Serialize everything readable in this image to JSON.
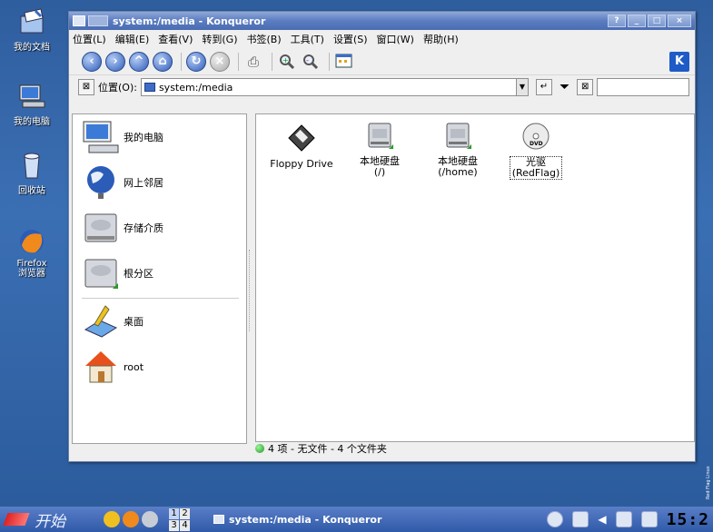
{
  "desktop": {
    "icons": [
      {
        "label": "我的文档",
        "icon": "documents-folder-icon"
      },
      {
        "label": "我的电脑",
        "icon": "computer-icon"
      },
      {
        "label": "回收站",
        "icon": "trash-icon"
      },
      {
        "label": "Firefox\n浏览器",
        "icon": "firefox-icon"
      }
    ],
    "watermark": "Red Flag Linux"
  },
  "window": {
    "title": "system:/media - Konqueror",
    "buttons": [
      "?",
      "_",
      "□",
      "×"
    ],
    "menu": [
      "位置(L)",
      "编辑(E)",
      "查看(V)",
      "转到(G)",
      "书签(B)",
      "工具(T)",
      "设置(S)",
      "窗口(W)",
      "帮助(H)"
    ],
    "toolbar": {
      "back": "back-icon",
      "forward": "forward-icon",
      "up": "up-icon",
      "home": "home-icon",
      "reload": "reload-icon",
      "stop": "stop-icon",
      "print": "print-icon",
      "zoom_in": "zoom-in-icon",
      "zoom_out": "zoom-out-icon",
      "view_mode": "view-mode-icon"
    },
    "location": {
      "label": "位置(O):",
      "value": "system:/media"
    },
    "sidebar": [
      {
        "label": "我的电脑",
        "icon": "computer-icon"
      },
      {
        "label": "网上邻居",
        "icon": "network-globe-icon"
      },
      {
        "label": "存储介质",
        "icon": "storage-drive-icon"
      },
      {
        "label": "根分区",
        "icon": "root-partition-icon"
      },
      {
        "label": "桌面",
        "icon": "desktop-icon"
      },
      {
        "label": "root",
        "icon": "home-folder-icon"
      }
    ],
    "files": [
      {
        "label": "Floppy Drive",
        "icon": "floppy-icon"
      },
      {
        "label": "本地硬盘\n(/)",
        "icon": "harddisk-icon"
      },
      {
        "label": "本地硬盘\n(/home)",
        "icon": "harddisk-icon"
      },
      {
        "label": "光驱\n(RedFlag)",
        "icon": "dvd-icon"
      }
    ],
    "status": "4 项 - 无文件 - 4 个文件夹"
  },
  "taskbar": {
    "start_label": "开始",
    "pager": [
      "1",
      "2",
      "3",
      "4"
    ],
    "task_label": "system:/media - Konqueror",
    "clock": "15:2"
  },
  "colors": {
    "titlebar": "#5a7cc0",
    "desktop": "#3b6fb4",
    "taskbar": "#2f5aa8"
  }
}
